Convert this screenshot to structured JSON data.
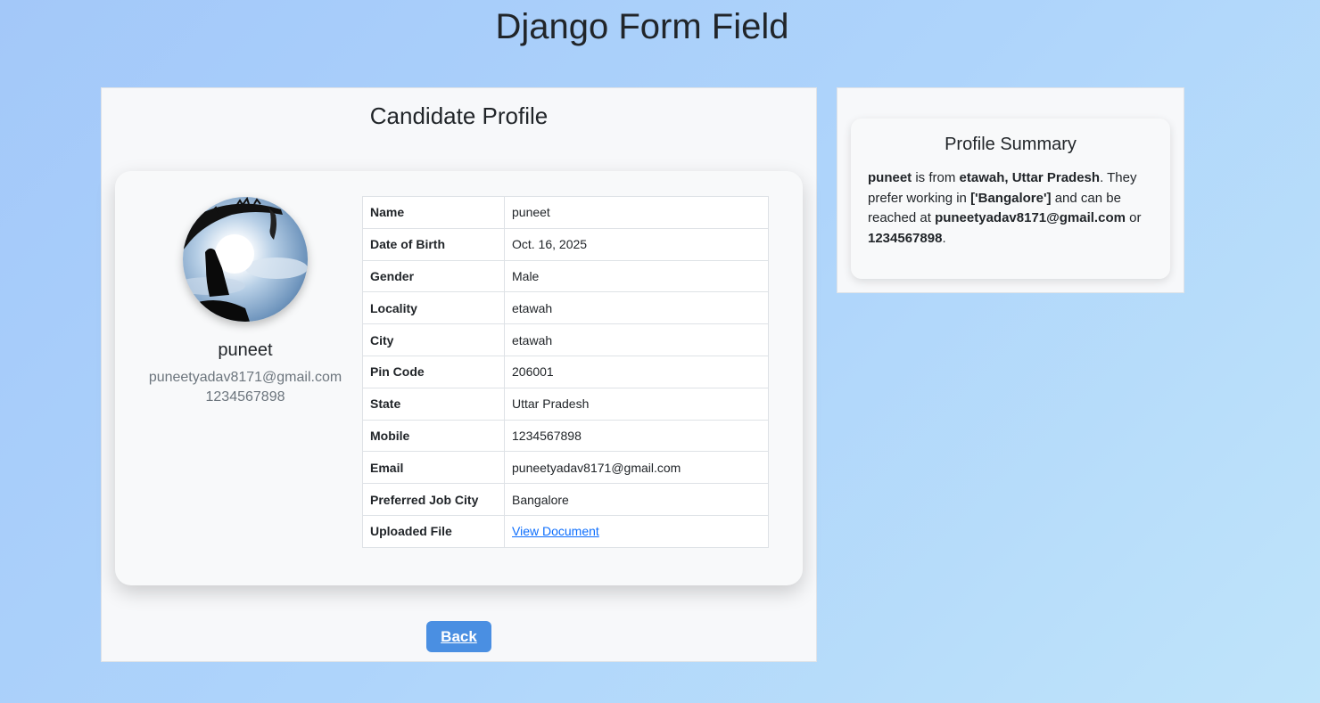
{
  "page": {
    "title": "Django Form Field"
  },
  "profile": {
    "heading": "Candidate Profile",
    "name": "puneet",
    "email": "puneetyadav8171@gmail.com",
    "phone": "1234567898",
    "avatar_icon": "profile-photo-silhouette"
  },
  "details": [
    {
      "label": "Name",
      "value": "puneet"
    },
    {
      "label": "Date of Birth",
      "value": "Oct. 16, 2025"
    },
    {
      "label": "Gender",
      "value": "Male"
    },
    {
      "label": "Locality",
      "value": "etawah"
    },
    {
      "label": "City",
      "value": "etawah"
    },
    {
      "label": "Pin Code",
      "value": "206001"
    },
    {
      "label": "State",
      "value": "Uttar Pradesh"
    },
    {
      "label": "Mobile",
      "value": "1234567898"
    },
    {
      "label": "Email",
      "value": "puneetyadav8171@gmail.com"
    },
    {
      "label": "Preferred Job City",
      "value": "Bangalore"
    },
    {
      "label": "Uploaded File",
      "value": "View Document"
    }
  ],
  "actions": {
    "back_label": "Back"
  },
  "summary": {
    "heading": "Profile Summary",
    "name": "puneet",
    "text_is_from": " is from ",
    "location": "etawah, Uttar Pradesh",
    "text_prefer": ". They prefer working in ",
    "cities": "['Bangalore']",
    "text_reached": " and can be reached at ",
    "email": "puneetyadav8171@gmail.com",
    "text_or": " or ",
    "phone": "1234567898",
    "text_end": "."
  },
  "colors": {
    "button": "#4a8fe2",
    "link": "#0d6efd",
    "muted_text": "#6c757d"
  }
}
